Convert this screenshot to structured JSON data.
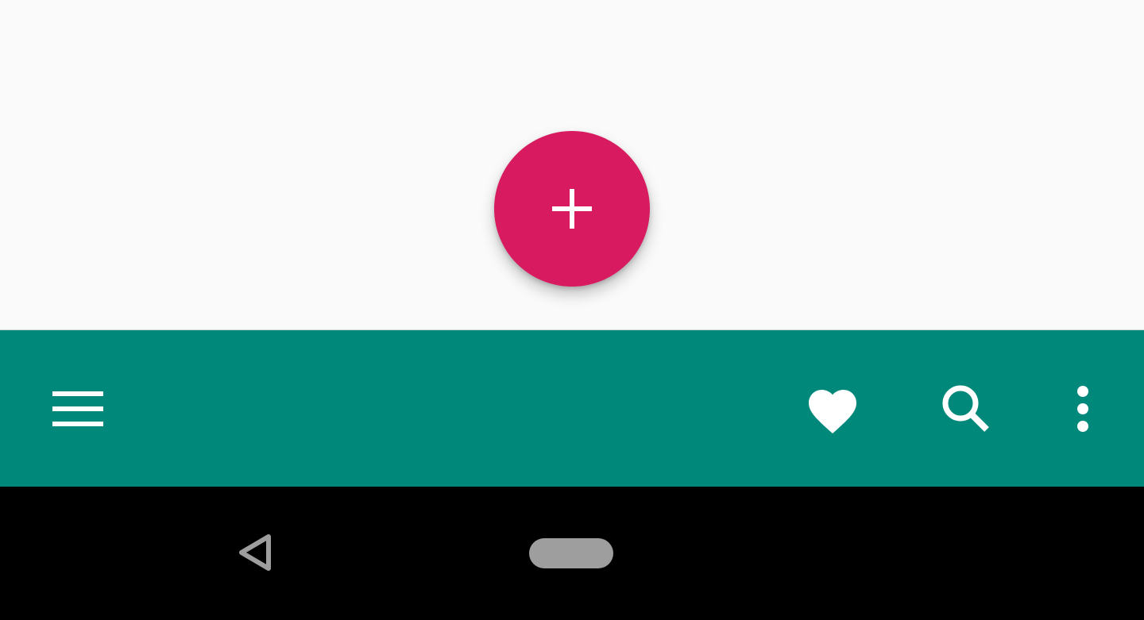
{
  "colors": {
    "background": "#fafafa",
    "bottom_app_bar": "#00897b",
    "fab": "#d81b60",
    "icon": "#ffffff",
    "nav_bar": "#000000",
    "nav_icon": "#9e9e9e"
  },
  "fab": {
    "icon": "add-icon"
  },
  "bottom_app_bar": {
    "navigation_icon": "menu-icon",
    "actions": [
      {
        "icon": "heart-icon"
      },
      {
        "icon": "search-icon"
      },
      {
        "icon": "more-vert-icon"
      }
    ]
  },
  "system_nav": {
    "back_icon": "back-triangle-icon",
    "home_icon": "home-pill-icon"
  }
}
